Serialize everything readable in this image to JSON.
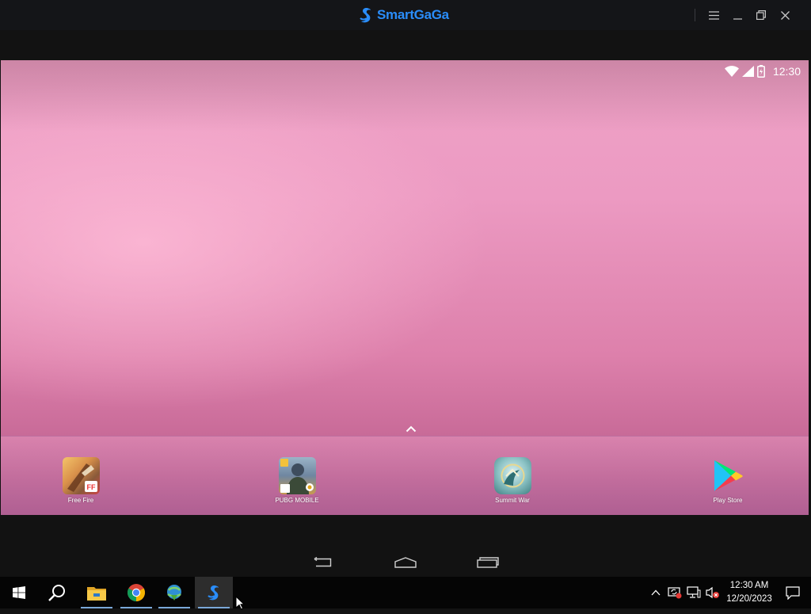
{
  "emulator": {
    "title": "SmartGaGa",
    "brand_color": "#2a8dfa",
    "window_controls": [
      "menu-icon",
      "minimize-icon",
      "restore-icon",
      "close-icon"
    ]
  },
  "android": {
    "status_bar": {
      "time": "12:30",
      "icons": [
        "wifi-icon",
        "signal-icon",
        "battery-icon"
      ]
    },
    "dock_apps": [
      {
        "label": "Free Fire",
        "icon": "free-fire-icon"
      },
      {
        "label": "PUBG MOBILE",
        "icon": "pubg-mobile-icon"
      },
      {
        "label": "Summit War",
        "icon": "summit-war-icon"
      },
      {
        "label": "Play Store",
        "icon": "play-store-icon"
      }
    ],
    "nav_buttons": [
      "back-icon",
      "home-icon",
      "recents-icon"
    ]
  },
  "taskbar": {
    "apps": [
      "windows-start-icon",
      "search-icon",
      "file-explorer-icon",
      "chrome-icon",
      "idm-icon",
      "smartgaga-icon"
    ],
    "tray_icons": [
      "show-hidden-icons",
      "update-icon",
      "network-icon",
      "volume-muted-icon"
    ],
    "clock": {
      "time": "12:30 AM",
      "date": "12/20/2023"
    }
  }
}
